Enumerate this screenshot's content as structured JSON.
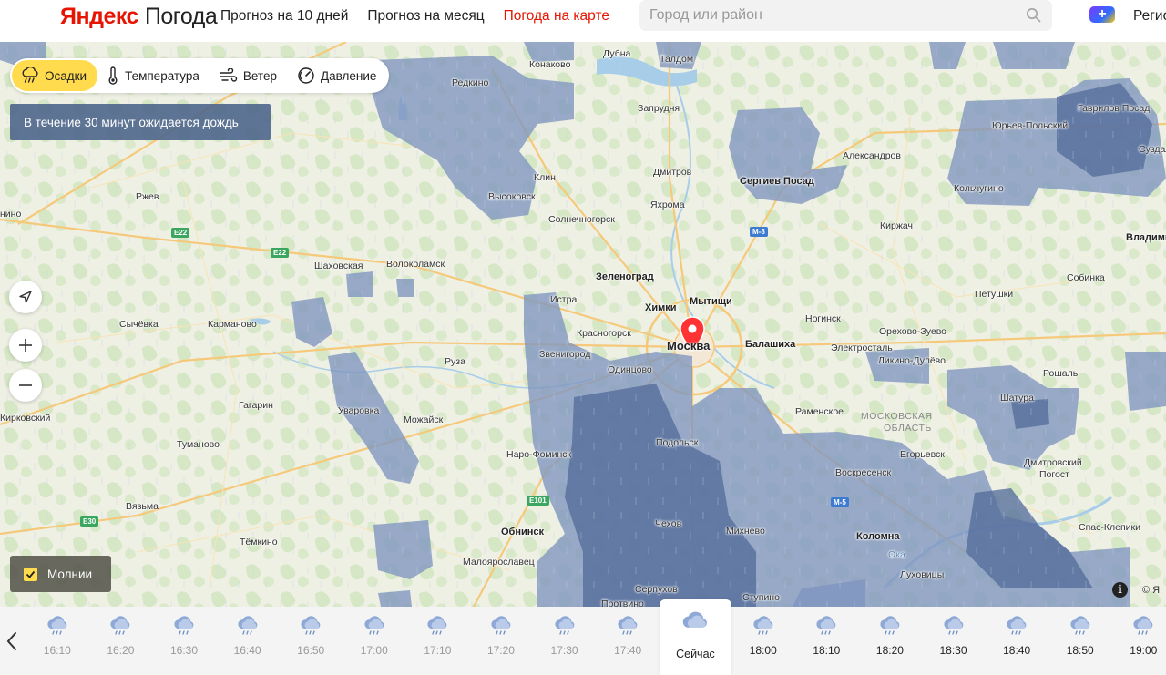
{
  "header": {
    "logo_brand": "Яндекс",
    "logo_product": "Погода",
    "nav": [
      {
        "label": "Прогноз на 10 дней",
        "active": false
      },
      {
        "label": "Прогноз на месяц",
        "active": false
      },
      {
        "label": "Погода на карте",
        "active": true
      }
    ],
    "search_placeholder": "Город или район",
    "plus_badge": "+",
    "region_link": "Регио"
  },
  "layers": [
    {
      "label": "Осадки",
      "icon": "rain-cloud-icon",
      "active": true
    },
    {
      "label": "Температура",
      "icon": "thermometer-icon",
      "active": false
    },
    {
      "label": "Ветер",
      "icon": "wind-icon",
      "active": false
    },
    {
      "label": "Давление",
      "icon": "pressure-gauge-icon",
      "active": false
    }
  ],
  "alert": "В течение 30 минут ожидается дождь",
  "lightning_label": "Молнии",
  "copyright": "© Я",
  "colors": {
    "accent_yellow": "#ffdb4d",
    "brand_red": "#e61400",
    "precip": "#4a6aa3"
  },
  "map_labels": [
    {
      "text": "Дубна"
    },
    {
      "text": "Конаково"
    },
    {
      "text": "Талдом"
    },
    {
      "text": "Редкино"
    },
    {
      "text": "Запрудня"
    },
    {
      "text": "Клин"
    },
    {
      "text": "Дмитров"
    },
    {
      "text": "Высоковск"
    },
    {
      "text": "Яхрома"
    },
    {
      "text": "Сергиев Посад"
    },
    {
      "text": "Александров"
    },
    {
      "text": "Юрьев-Польский"
    },
    {
      "text": "Гаврилов Посад"
    },
    {
      "text": "Кольчугино"
    },
    {
      "text": "Суздаль"
    },
    {
      "text": "Ржев"
    },
    {
      "text": "Солнечногорск"
    },
    {
      "text": "Киржач"
    },
    {
      "text": "Владими"
    },
    {
      "text": "Шаховская"
    },
    {
      "text": "Волоколамск"
    },
    {
      "text": "Зеленоград"
    },
    {
      "text": "Собинка"
    },
    {
      "text": "Истра"
    },
    {
      "text": "Химки"
    },
    {
      "text": "Мытищи"
    },
    {
      "text": "Петушки"
    },
    {
      "text": "Сычёвка"
    },
    {
      "text": "Карманово"
    },
    {
      "text": "Ногинск"
    },
    {
      "text": "Красногорск"
    },
    {
      "text": "Москва"
    },
    {
      "text": "Балашиха"
    },
    {
      "text": "Электросталь"
    },
    {
      "text": "Орехово-Зуево"
    },
    {
      "text": "Звенигород"
    },
    {
      "text": "Ликино-Дулёво"
    },
    {
      "text": "Руза"
    },
    {
      "text": "Одинцово"
    },
    {
      "text": "Рошаль"
    },
    {
      "text": "Шатура"
    },
    {
      "text": "Уваровка"
    },
    {
      "text": "Гагарин"
    },
    {
      "text": "Можайск"
    },
    {
      "text": "Раменское"
    },
    {
      "text": "МОСКОВСКАЯ"
    },
    {
      "text": "ОБЛАСТЬ"
    },
    {
      "text": "Кирковский"
    },
    {
      "text": "Туманово"
    },
    {
      "text": "Подольск"
    },
    {
      "text": "Наро-Фоминск"
    },
    {
      "text": "Егорьевск"
    },
    {
      "text": "Дмитровский"
    },
    {
      "text": "Погост"
    },
    {
      "text": "Воскресенск"
    },
    {
      "text": "Вязьма"
    },
    {
      "text": "Чехов"
    },
    {
      "text": "Обнинск"
    },
    {
      "text": "Михнево"
    },
    {
      "text": "Спас-Клепики"
    },
    {
      "text": "Малоярославец"
    },
    {
      "text": "Тёмкино"
    },
    {
      "text": "Коломна"
    },
    {
      "text": "Серпухов"
    },
    {
      "text": "Луховицы"
    },
    {
      "text": "Протвино"
    },
    {
      "text": "Ступино"
    },
    {
      "text": "Ока"
    },
    {
      "text": "нино"
    }
  ],
  "road_badges": [
    {
      "text": "E22",
      "color": "green"
    },
    {
      "text": "E22",
      "color": "green"
    },
    {
      "text": "M-8",
      "color": "blue"
    },
    {
      "text": "M-5",
      "color": "blue"
    },
    {
      "text": "E101",
      "color": "green"
    },
    {
      "text": "E30",
      "color": "green"
    }
  ],
  "timeline": [
    {
      "time": "16:10",
      "state": "past"
    },
    {
      "time": "16:20",
      "state": "past"
    },
    {
      "time": "16:30",
      "state": "past"
    },
    {
      "time": "16:40",
      "state": "past"
    },
    {
      "time": "16:50",
      "state": "past"
    },
    {
      "time": "17:00",
      "state": "past"
    },
    {
      "time": "17:10",
      "state": "past"
    },
    {
      "time": "17:20",
      "state": "past"
    },
    {
      "time": "17:30",
      "state": "past"
    },
    {
      "time": "17:40",
      "state": "past"
    },
    {
      "time": "Сейчас",
      "state": "now"
    },
    {
      "time": "18:00",
      "state": "future"
    },
    {
      "time": "18:10",
      "state": "future"
    },
    {
      "time": "18:20",
      "state": "future"
    },
    {
      "time": "18:30",
      "state": "future"
    },
    {
      "time": "18:40",
      "state": "future"
    },
    {
      "time": "18:50",
      "state": "future"
    },
    {
      "time": "19:00",
      "state": "future"
    }
  ]
}
